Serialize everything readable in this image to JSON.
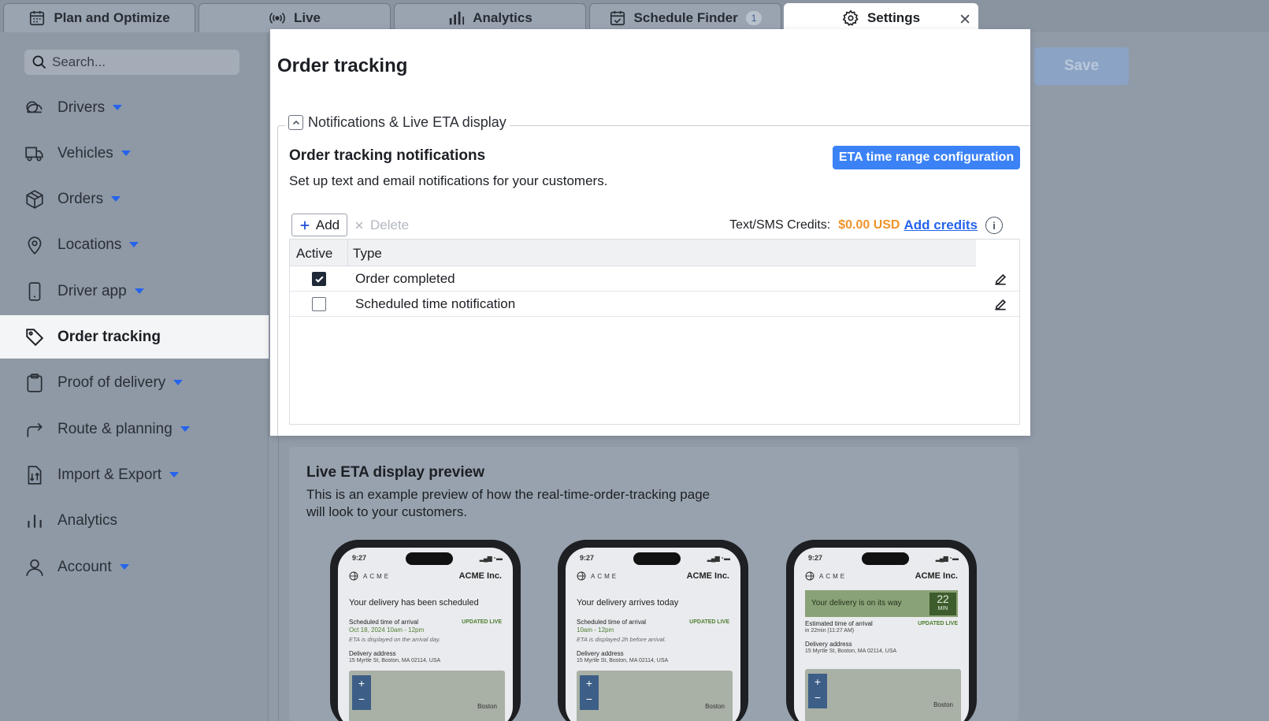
{
  "tabs": [
    {
      "label": "Plan and Optimize",
      "icon": "calendar-grid-icon"
    },
    {
      "label": "Live",
      "icon": "broadcast-icon"
    },
    {
      "label": "Analytics",
      "icon": "bar-chart-icon"
    },
    {
      "label": "Schedule Finder",
      "icon": "calendar-check-icon",
      "count": "1"
    },
    {
      "label": "Settings",
      "icon": "gear-icon",
      "active": true
    }
  ],
  "sidebar": {
    "search_placeholder": "Search...",
    "items": [
      {
        "label": "Drivers",
        "icon": "drivers-icon",
        "has_caret": true
      },
      {
        "label": "Vehicles",
        "icon": "truck-icon",
        "has_caret": true
      },
      {
        "label": "Orders",
        "icon": "package-icon",
        "has_caret": true
      },
      {
        "label": "Locations",
        "icon": "map-pin-icon",
        "has_caret": true
      },
      {
        "label": "Driver app",
        "icon": "phone-icon",
        "has_caret": true
      },
      {
        "label": "Order tracking",
        "icon": "tag-icon",
        "active": true
      },
      {
        "label": "Proof of delivery",
        "icon": "clipboard-icon",
        "has_caret": true
      },
      {
        "label": "Route & planning",
        "icon": "route-arrow-icon",
        "has_caret": true
      },
      {
        "label": "Import & Export",
        "icon": "import-export-icon",
        "has_caret": true
      },
      {
        "label": "Analytics",
        "icon": "analytics-icon"
      },
      {
        "label": "Account",
        "icon": "user-icon",
        "has_caret": true
      }
    ]
  },
  "header": {
    "save_label": "Save"
  },
  "modal": {
    "title": "Order tracking",
    "section_legend": "Notifications & Live ETA display",
    "notifications_title": "Order tracking notifications",
    "notifications_desc": "Set up text and email notifications for your customers.",
    "eta_button": "ETA time range configuration",
    "add_label": "Add",
    "delete_label": "Delete",
    "credits_label": "Text/SMS Credits:",
    "credits_amount": "$0.00 USD",
    "add_credits_label": "Add credits",
    "table": {
      "columns": [
        "Active",
        "Type"
      ],
      "rows": [
        {
          "active": true,
          "type": "Order completed"
        },
        {
          "active": false,
          "type": "Scheduled time notification"
        }
      ]
    }
  },
  "preview": {
    "title": "Live ETA display preview",
    "description": "This is an example preview of how the real-time-order-tracking page will look to your customers.",
    "phones": [
      {
        "time": "9:27",
        "brand": "ACME",
        "company": "ACME Inc.",
        "headline": "Your delivery has been scheduled",
        "arrival_label": "Scheduled time of arrival",
        "updated": "UPDATED LIVE",
        "arrival_value": "Oct 18, 2024  10am - 12pm",
        "note": "ETA is displayed on the arrival day.",
        "address_label": "Delivery address",
        "address": "15 Myrtle St, Boston, MA 02114, USA",
        "city": "Boston"
      },
      {
        "time": "9:27",
        "brand": "ACME",
        "company": "ACME Inc.",
        "headline": "Your delivery arrives today",
        "arrival_label": "Scheduled time of arrival",
        "updated": "UPDATED LIVE",
        "arrival_value": "10am - 12pm",
        "note": "ETA is displayed 2h before arrival.",
        "address_label": "Delivery address",
        "address": "15 Myrtle St, Boston, MA 02114, USA",
        "city": "Boston"
      },
      {
        "time": "9:27",
        "brand": "ACME",
        "company": "ACME Inc.",
        "headline": "Your delivery is on its way",
        "eta_minutes": "22",
        "eta_unit": "MIN",
        "arrival_label": "Estimated time of arrival",
        "updated": "UPDATED LIVE",
        "arrival_value": "in 22min (11:27 AM)",
        "address_label": "Delivery address",
        "address": "15 Myrtle St, Boston, MA 02114, USA",
        "city": "Boston"
      }
    ]
  },
  "colors": {
    "accent": "#3b82f6",
    "credits": "#f0932b",
    "link": "#2563eb"
  }
}
